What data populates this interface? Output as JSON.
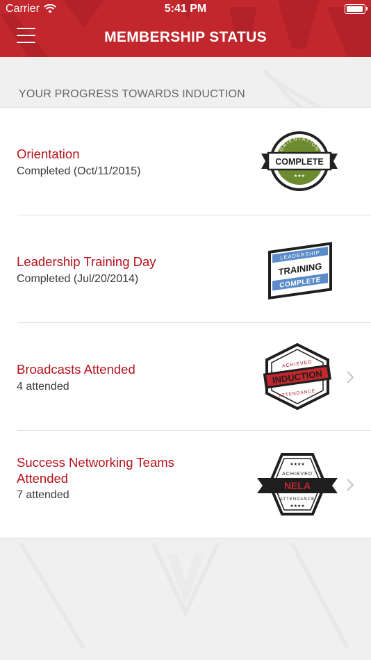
{
  "status_bar": {
    "carrier": "Carrier",
    "time": "5:41 PM",
    "battery_level": 1.0
  },
  "nav": {
    "title": "MEMBERSHIP STATUS",
    "menu_icon": "hamburger-menu-icon"
  },
  "section": {
    "header": "YOUR PROGRESS TOWARDS INDUCTION"
  },
  "colors": {
    "brand_red": "#c1272d",
    "title_red": "#b5121b",
    "badge_olive": "#6d8b2e",
    "badge_blue": "#5b8cc9"
  },
  "items": [
    {
      "title": "Orientation",
      "subtitle": "Completed (Oct/11/2015)",
      "badge": {
        "icon": "orientation-complete-badge-icon",
        "top_text": "ORIENTATION",
        "main_text": "COMPLETE",
        "stars": "★★★"
      },
      "has_chevron": false
    },
    {
      "title": "Leadership Training Day",
      "subtitle": "Completed (Jul/20/2014)",
      "badge": {
        "icon": "training-complete-badge-icon",
        "top_text": "LEADERSHIP",
        "main_text": "TRAINING",
        "bottom_text": "COMPLETE"
      },
      "has_chevron": false
    },
    {
      "title": "Broadcasts Attended",
      "subtitle": "4 attended",
      "badge": {
        "icon": "induction-attendance-badge-icon",
        "top_text": "ACHIEVED",
        "main_text": "INDUCTION",
        "bottom_text": "ATTENDANCE"
      },
      "has_chevron": true
    },
    {
      "title": "Success Networking Teams Attended",
      "subtitle": "7 attended",
      "badge": {
        "icon": "nela-attendance-badge-icon",
        "top_text": "ACHIEVED",
        "main_text": "NELA",
        "bottom_text": "ATTENDANCE",
        "stars": "★★★★"
      },
      "has_chevron": true
    }
  ]
}
